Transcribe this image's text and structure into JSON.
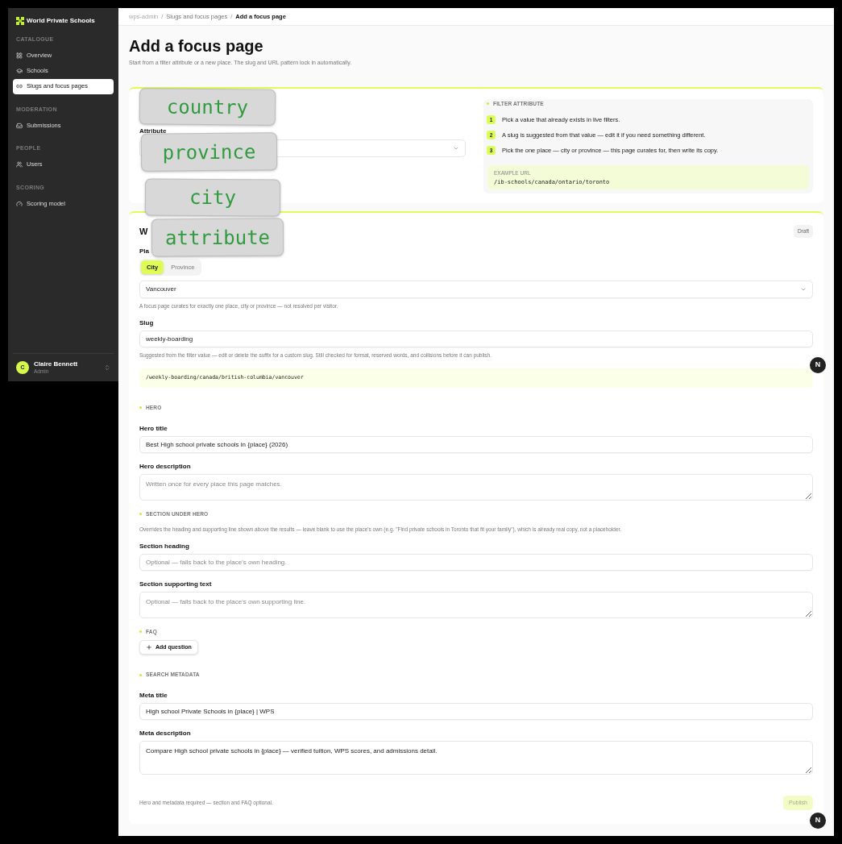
{
  "sidebar": {
    "brand": "World Private Schools",
    "groups": [
      {
        "heading": "CATALOGUE",
        "items": [
          {
            "label": "Overview",
            "selected": false
          },
          {
            "label": "Schools",
            "selected": false
          },
          {
            "label": "Slugs and focus pages",
            "selected": true
          }
        ]
      },
      {
        "heading": "MODERATION",
        "items": [
          {
            "label": "Submissions",
            "selected": false
          }
        ]
      },
      {
        "heading": "PEOPLE",
        "items": [
          {
            "label": "Users",
            "selected": false
          }
        ]
      },
      {
        "heading": "SCORING",
        "items": [
          {
            "label": "Scoring model",
            "selected": false
          }
        ]
      }
    ],
    "user": {
      "initial": "C",
      "name": "Claire Bennett",
      "role": "Admin"
    }
  },
  "breadcrumb": {
    "separator": "/",
    "items": [
      "wps-admin",
      "Slugs and focus pages",
      "Add a focus page"
    ]
  },
  "page": {
    "title": "Add a focus page",
    "subtitle": "Start from a filter attribute or a new place. The slug and URL pattern lock in automatically."
  },
  "source_card": {
    "attribute_label": "Attribute",
    "steps_heading": "FILTER ATTRIBUTE",
    "steps": [
      {
        "number": "1",
        "text": "Pick a value that already exists in live filters."
      },
      {
        "number": "2",
        "text": "A slug is suggested from that value — edit it if you need something different."
      },
      {
        "number": "3",
        "text": "Pick the one place — city or province — this page curates for, then write its copy."
      }
    ],
    "example": {
      "label": "EXAMPLE URL",
      "url": "/ib-schools/canada/ontario/toronto"
    }
  },
  "focus_card": {
    "heading": "W",
    "status": "Draft",
    "blocks": [
      {
        "kind": "label",
        "text": "Pla"
      },
      {
        "kind": "segments",
        "options": [
          {
            "label": "City",
            "selected": true
          },
          {
            "label": "Province",
            "selected": false
          }
        ]
      },
      {
        "kind": "select",
        "value": "Vancouver"
      },
      {
        "kind": "help",
        "text": "A focus page curates for exactly one place, city or province — not resolved per visitor."
      },
      {
        "kind": "label",
        "text": "Slug"
      },
      {
        "kind": "input",
        "value": "weekly-boarding"
      },
      {
        "kind": "help",
        "text": "Suggested from the filter value — edit or delete the suffix for a custom slug. Still checked for format, reserved words, and collisions before it can publish."
      },
      {
        "kind": "url",
        "text": "/weekly-boarding/canada/british-columbia/vancouver"
      },
      {
        "kind": "section",
        "text": "HERO"
      },
      {
        "kind": "label",
        "text": "Hero title"
      },
      {
        "kind": "input",
        "value": "Best High school private schools in {place} (2026)"
      },
      {
        "kind": "label",
        "text": "Hero description"
      },
      {
        "kind": "textarea",
        "placeholder": "Written once for every place this page matches."
      },
      {
        "kind": "section",
        "text": "SECTION UNDER HERO"
      },
      {
        "kind": "help",
        "text": "Overrides the heading and supporting line shown above the results — leave blank to use the place's own (e.g. \"Find private schools in Toronto that fit your family\"), which is already real copy, not a placeholder."
      },
      {
        "kind": "label",
        "text": "Section heading"
      },
      {
        "kind": "input",
        "placeholder": "Optional — falls back to the place's own heading."
      },
      {
        "kind": "label",
        "text": "Section supporting text"
      },
      {
        "kind": "textarea",
        "placeholder": "Optional — falls back to the place's own supporting line."
      },
      {
        "kind": "section",
        "text": "FAQ"
      },
      {
        "kind": "button",
        "text": "Add question"
      },
      {
        "kind": "section",
        "text": "SEARCH METADATA"
      },
      {
        "kind": "label",
        "text": "Meta title"
      },
      {
        "kind": "input",
        "value": "High school Private Schools in {place} | WPS"
      },
      {
        "kind": "label",
        "text": "Meta description"
      },
      {
        "kind": "textarea",
        "value": "Compare High school private schools in {place} — verified tuition, WPS scores, and admissions detail.",
        "tall": true
      }
    ],
    "footer_note": "Hero and metadata required — section and FAQ optional.",
    "publish": {
      "label": "Publish",
      "disabled": true
    }
  },
  "notes": [
    "country",
    "province",
    "city",
    "attribute"
  ],
  "dev_badges": [
    "N",
    "N"
  ]
}
